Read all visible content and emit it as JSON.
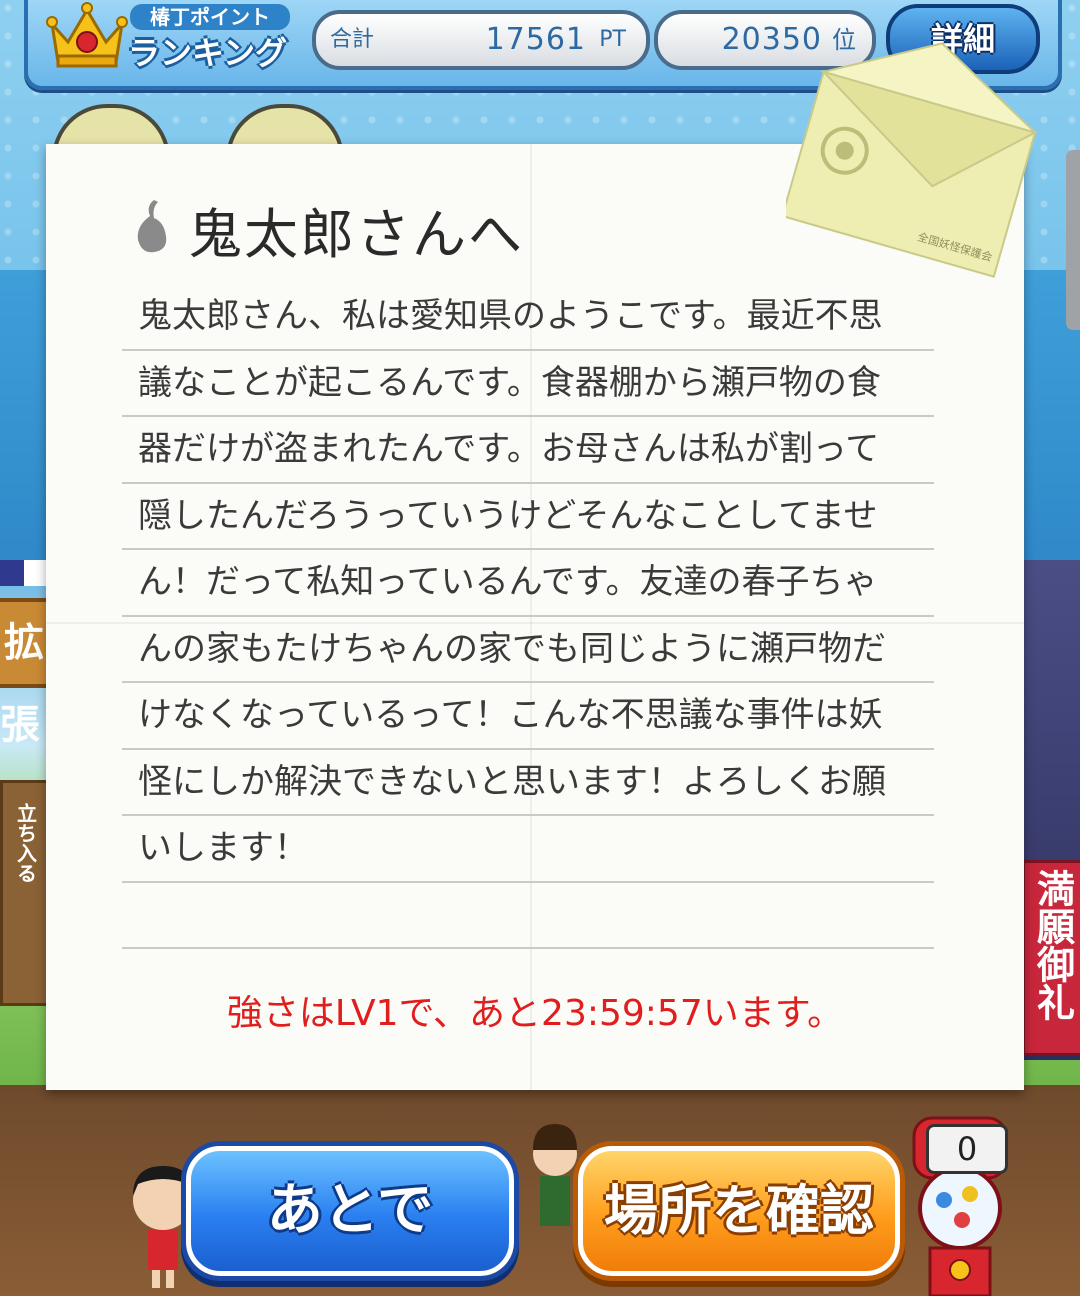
{
  "ranking": {
    "title_small": "椿丁ポイント",
    "title_big": "ランキング",
    "total_label": "合計",
    "total_value": "17561",
    "total_unit": "PT",
    "rank_value": "20350",
    "rank_unit": "位",
    "detail_button": "詳細"
  },
  "letter": {
    "greeting": "鬼太郎さんへ",
    "lines": [
      "鬼太郎さん、私は愛知県のようこです。最近不思",
      "議なことが起こるんです。食器棚から瀬戸物の食",
      "器だけが盗まれたんです。お母さんは私が割って",
      "隠したんだろうっていうけどそんなことしてませ",
      "ん！だって私知っているんです。友達の春子ちゃ",
      "んの家もたけちゃんの家でも同じように瀬戸物だ",
      "けなくなっているって！こんな不思議な事件は妖",
      "怪にしか解決できないと思います！よろしくお願",
      "いします！",
      ""
    ],
    "strength_text": "強さはLV1で、あと23:59:57います。",
    "envelope_stamp": "全国妖怪保護会"
  },
  "background": {
    "side_sign": "拡張",
    "post_text": "立ち入る",
    "banner_text": "満願御礼"
  },
  "buttons": {
    "later": "あとで",
    "confirm_location": "場所を確認"
  },
  "gacha": {
    "count": "0"
  },
  "colors": {
    "strength_text": "#e01e1e",
    "later_button": "#2a7ff0",
    "confirm_button": "#ff9d1c",
    "top_bar": "#6ab6ea"
  }
}
